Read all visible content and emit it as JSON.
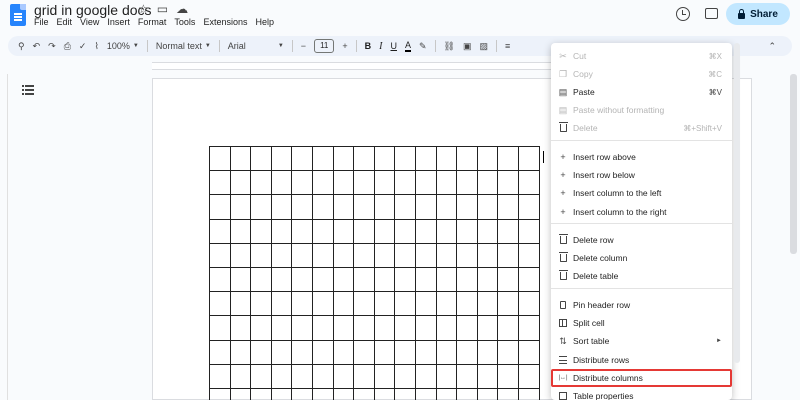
{
  "doc": {
    "title": "grid in google docs",
    "menu": [
      "File",
      "Edit",
      "View",
      "Insert",
      "Format",
      "Tools",
      "Extensions",
      "Help"
    ],
    "share_label": "Share"
  },
  "toolbar": {
    "zoom": "100%",
    "style": "Normal text",
    "font": "Arial",
    "font_size": "11",
    "bold": "B",
    "italic": "I",
    "underline": "U",
    "text_color": "A"
  },
  "context_menu": {
    "items": [
      {
        "label": "Cut",
        "shortcut": "⌘X",
        "icon": "scissors-icon",
        "disabled": true
      },
      {
        "label": "Copy",
        "shortcut": "⌘C",
        "icon": "copy-icon",
        "disabled": true
      },
      {
        "label": "Paste",
        "shortcut": "⌘V",
        "icon": "clipboard-icon",
        "disabled": false
      },
      {
        "label": "Paste without formatting",
        "shortcut": "",
        "icon": "clipboard-plain-icon",
        "disabled": true
      },
      {
        "label": "Delete",
        "shortcut": "⌘+Shift+V",
        "icon": "trash-icon",
        "disabled": true
      },
      {
        "label": "Insert row above",
        "icon": "plus-icon"
      },
      {
        "label": "Insert row below",
        "icon": "plus-icon"
      },
      {
        "label": "Insert column to the left",
        "icon": "plus-icon"
      },
      {
        "label": "Insert column to the right",
        "icon": "plus-icon"
      },
      {
        "label": "Delete row",
        "icon": "trash-icon"
      },
      {
        "label": "Delete column",
        "icon": "trash-icon"
      },
      {
        "label": "Delete table",
        "icon": "trash-icon"
      },
      {
        "label": "Pin header row",
        "icon": "pin-icon"
      },
      {
        "label": "Split cell",
        "icon": "split-cell-icon"
      },
      {
        "label": "Sort table",
        "icon": "sort-icon",
        "submenu_arrow": "►"
      },
      {
        "label": "Distribute rows",
        "icon": "distribute-rows-icon"
      },
      {
        "label": "Distribute columns",
        "icon": "distribute-columns-icon",
        "highlighted": true
      },
      {
        "label": "Table properties",
        "icon": "table-properties-icon"
      }
    ]
  },
  "table": {
    "columns": 16,
    "rows": 11
  },
  "colors": {
    "accent": "#c2e7ff",
    "highlight_border": "#e53935",
    "docs_blue": "#2684fc"
  }
}
